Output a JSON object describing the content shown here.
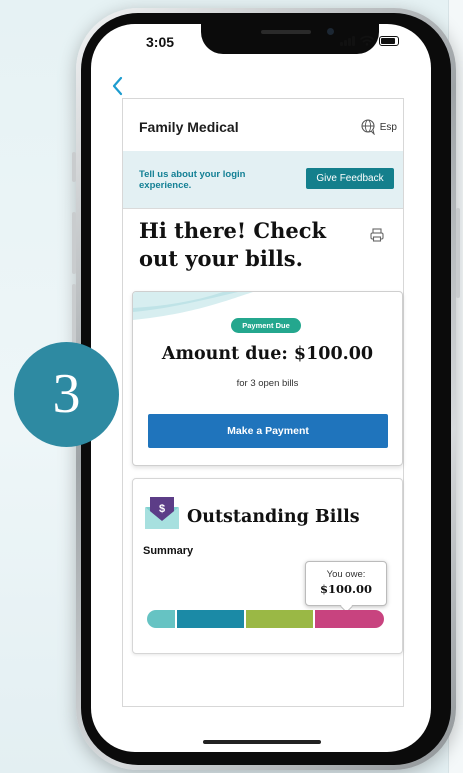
{
  "status_bar": {
    "time": "3:05"
  },
  "header": {
    "brand": "Family Medical",
    "language_label": "Esp"
  },
  "feedback_banner": {
    "message": "Tell us about your login experience.",
    "button_label": "Give Feedback"
  },
  "greeting": "Hi there! Check out your bills.",
  "amount_card": {
    "status_badge": "Payment Due",
    "title": "Amount due: $100.00",
    "subtitle": "for 3 open bills",
    "pay_button": "Make a Payment"
  },
  "bills_card": {
    "title": "Outstanding Bills",
    "summary_label": "Summary",
    "tooltip_label": "You owe:",
    "tooltip_amount": "$100.00",
    "segments": [
      {
        "color": "#66c3c3",
        "share": 0.12
      },
      {
        "color": "#1b8aa6",
        "share": 0.29
      },
      {
        "color": "#9ab845",
        "share": 0.29
      },
      {
        "color": "#c8437f",
        "share": 0.3
      }
    ]
  },
  "step_badge": "3",
  "icons": [
    "back-chevron-icon",
    "globe-chat-icon",
    "printer-icon",
    "dollar-envelope-icon",
    "signal-icon",
    "wifi-icon",
    "battery-icon"
  ],
  "colors": {
    "accent_teal": "#148095",
    "pay_button": "#1f74bc",
    "status_badge": "#24a78e",
    "step_badge": "#2e8aa2",
    "banner_bg": "#e3f0f3"
  }
}
